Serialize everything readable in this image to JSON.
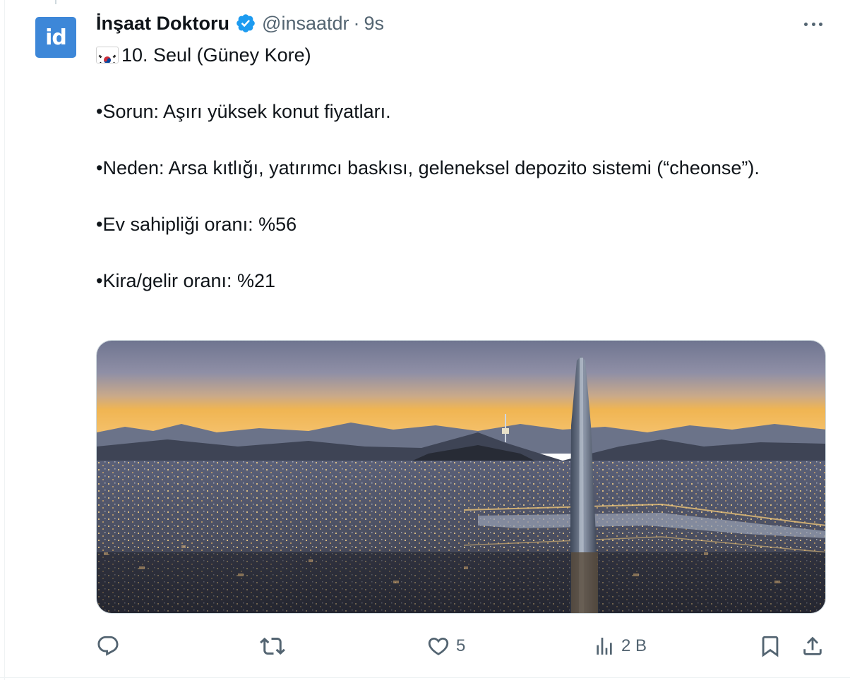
{
  "tweet": {
    "author": {
      "avatar_text": "id",
      "display_name": "İnşaat Doktoru",
      "handle": "@insaatdr",
      "separator": "·",
      "time": "9s",
      "avatar_color": "#3d87d8",
      "verified_color": "#1d9bf0"
    },
    "flag_emoji": "south-korea-flag-icon",
    "text": {
      "line1": "10. Seul (Güney Kore)",
      "line2": "•Sorun: Aşırı yüksek konut fiyatları.",
      "line3": "•Neden: Arsa kıtlığı, yatırımcı baskısı, geleneksel depozito sistemi (“cheonse”).",
      "line4": "•Ev sahipliği oranı: %56",
      "line5": "•Kira/gelir oranı: %21"
    },
    "media": {
      "type": "photo",
      "subject": "seoul-skyline-at-dusk"
    },
    "actions": {
      "reply_count": "",
      "retweet_count": "",
      "like_count": "5",
      "views_count": "2 B"
    }
  }
}
